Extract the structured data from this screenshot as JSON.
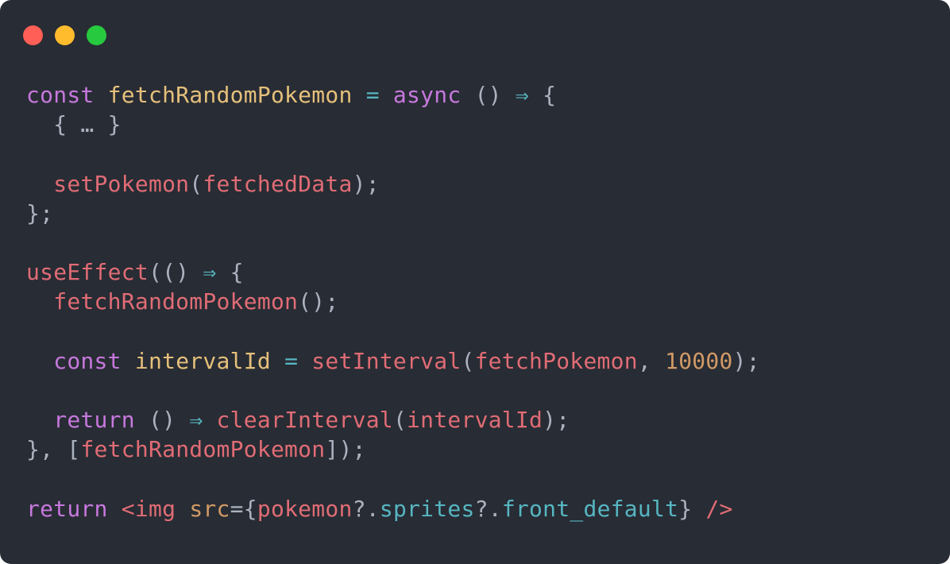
{
  "window": {
    "buttons": [
      {
        "name": "close-button",
        "color": "#ff5f56"
      },
      {
        "name": "minimize-button",
        "color": "#ffbd2e"
      },
      {
        "name": "zoom-button",
        "color": "#27c93f"
      }
    ]
  },
  "theme": {
    "background": "#282c34",
    "keyword": "#c678dd",
    "function_def": "#e5c07b",
    "operator": "#56b6c2",
    "punctuation": "#abb2bf",
    "identifier": "#e06c75",
    "number": "#d19a66",
    "property": "#56b6c2"
  },
  "code": {
    "lines": [
      {
        "tokens": [
          {
            "t": "const",
            "k": "keyword"
          },
          {
            "t": " ",
            "k": "punctuation"
          },
          {
            "t": "fetchRandomPokemon",
            "k": "function_def"
          },
          {
            "t": " ",
            "k": "punctuation"
          },
          {
            "t": "=",
            "k": "operator"
          },
          {
            "t": " ",
            "k": "punctuation"
          },
          {
            "t": "async",
            "k": "keyword"
          },
          {
            "t": " () ",
            "k": "punctuation"
          },
          {
            "t": "⇒",
            "k": "operator"
          },
          {
            "t": " {",
            "k": "punctuation"
          }
        ]
      },
      {
        "tokens": [
          {
            "t": "  ",
            "k": "punctuation"
          },
          {
            "t": "{ … }",
            "k": "punctuation",
            "fold": true
          }
        ]
      },
      {
        "tokens": []
      },
      {
        "tokens": [
          {
            "t": "  ",
            "k": "punctuation"
          },
          {
            "t": "setPokemon",
            "k": "identifier"
          },
          {
            "t": "(",
            "k": "punctuation"
          },
          {
            "t": "fetchedData",
            "k": "identifier"
          },
          {
            "t": ");",
            "k": "punctuation"
          }
        ]
      },
      {
        "tokens": [
          {
            "t": "};",
            "k": "punctuation"
          }
        ]
      },
      {
        "tokens": []
      },
      {
        "tokens": [
          {
            "t": "useEffect",
            "k": "identifier"
          },
          {
            "t": "(() ",
            "k": "punctuation"
          },
          {
            "t": "⇒",
            "k": "operator"
          },
          {
            "t": " {",
            "k": "punctuation"
          }
        ]
      },
      {
        "tokens": [
          {
            "t": "  ",
            "k": "punctuation"
          },
          {
            "t": "fetchRandomPokemon",
            "k": "identifier"
          },
          {
            "t": "();",
            "k": "punctuation"
          }
        ]
      },
      {
        "tokens": []
      },
      {
        "tokens": [
          {
            "t": "  ",
            "k": "punctuation"
          },
          {
            "t": "const",
            "k": "keyword"
          },
          {
            "t": " ",
            "k": "punctuation"
          },
          {
            "t": "intervalId",
            "k": "function_def"
          },
          {
            "t": " ",
            "k": "punctuation"
          },
          {
            "t": "=",
            "k": "operator"
          },
          {
            "t": " ",
            "k": "punctuation"
          },
          {
            "t": "setInterval",
            "k": "identifier"
          },
          {
            "t": "(",
            "k": "punctuation"
          },
          {
            "t": "fetchPokemon",
            "k": "identifier"
          },
          {
            "t": ", ",
            "k": "punctuation"
          },
          {
            "t": "10000",
            "k": "number"
          },
          {
            "t": ");",
            "k": "punctuation"
          }
        ]
      },
      {
        "tokens": []
      },
      {
        "tokens": [
          {
            "t": "  ",
            "k": "punctuation"
          },
          {
            "t": "return",
            "k": "keyword"
          },
          {
            "t": " () ",
            "k": "punctuation"
          },
          {
            "t": "⇒",
            "k": "operator"
          },
          {
            "t": " ",
            "k": "punctuation"
          },
          {
            "t": "clearInterval",
            "k": "identifier"
          },
          {
            "t": "(",
            "k": "punctuation"
          },
          {
            "t": "intervalId",
            "k": "identifier"
          },
          {
            "t": ");",
            "k": "punctuation"
          }
        ]
      },
      {
        "tokens": [
          {
            "t": "}, [",
            "k": "punctuation"
          },
          {
            "t": "fetchRandomPokemon",
            "k": "identifier"
          },
          {
            "t": "]);",
            "k": "punctuation"
          }
        ]
      },
      {
        "tokens": []
      },
      {
        "tokens": [
          {
            "t": "return",
            "k": "keyword"
          },
          {
            "t": " ",
            "k": "punctuation"
          },
          {
            "t": "<img",
            "k": "identifier"
          },
          {
            "t": " ",
            "k": "punctuation"
          },
          {
            "t": "src",
            "k": "number"
          },
          {
            "t": "={",
            "k": "punctuation"
          },
          {
            "t": "pokemon",
            "k": "identifier"
          },
          {
            "t": "?.",
            "k": "punctuation"
          },
          {
            "t": "sprites",
            "k": "property"
          },
          {
            "t": "?.",
            "k": "punctuation"
          },
          {
            "t": "front_default",
            "k": "property"
          },
          {
            "t": "}",
            "k": "punctuation"
          },
          {
            "t": " ",
            "k": "punctuation"
          },
          {
            "t": "/>",
            "k": "identifier"
          }
        ]
      }
    ]
  }
}
